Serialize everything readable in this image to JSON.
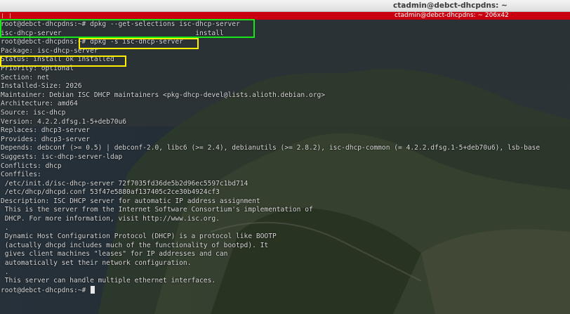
{
  "window": {
    "title": "ctadmin@debct-dhcpdns: ~",
    "tab_title": "ctadmin@debct-dhcpdns: ~ 206x42"
  },
  "terminal": {
    "lines": [
      "root@debct-dhcpdns:~# dpkg --get-selections isc-dhcp-server",
      "isc-dhcp-server                                 install",
      "root@debct-dhcpdns:~# dpkg -s isc-dhcp-server",
      "Package: isc-dhcp-server",
      "Status: install ok installed",
      "Priority: optional",
      "Section: net",
      "Installed-Size: 2026",
      "Maintainer: Debian ISC DHCP maintainers <pkg-dhcp-devel@lists.alioth.debian.org>",
      "Architecture: amd64",
      "Source: isc-dhcp",
      "Version: 4.2.2.dfsg.1-5+deb70u6",
      "Replaces: dhcp3-server",
      "Provides: dhcp3-server",
      "Depends: debconf (>= 0.5) | debconf-2.0, libc6 (>= 2.4), debianutils (>= 2.8.2), isc-dhcp-common (= 4.2.2.dfsg.1-5+deb70u6), lsb-base",
      "Suggests: isc-dhcp-server-ldap",
      "Conflicts: dhcp",
      "Conffiles:",
      " /etc/init.d/isc-dhcp-server 72f7035fd36de5b2d96ec5597c1bd714",
      " /etc/dhcp/dhcpd.conf 53f47e5880af137405c2ce30b4924cf3",
      "Description: ISC DHCP server for automatic IP address assignment",
      " This is the server from the Internet Software Consortium's implementation of",
      " DHCP. For more information, visit http://www.isc.org.",
      " .",
      " Dynamic Host Configuration Protocol (DHCP) is a protocol like BOOTP",
      " (actually dhcpd includes much of the functionality of bootpd). It",
      " gives client machines \"leases\" for IP addresses and can",
      " automatically set their network configuration.",
      " .",
      " This server can handle multiple ethernet interfaces."
    ],
    "prompt": "root@debct-dhcpdns:~# "
  },
  "colors": {
    "highlight_green": "#19e619",
    "highlight_yellow": "#ffee00",
    "tab_bar": "#c8000f",
    "text": "#d9d9d9"
  }
}
